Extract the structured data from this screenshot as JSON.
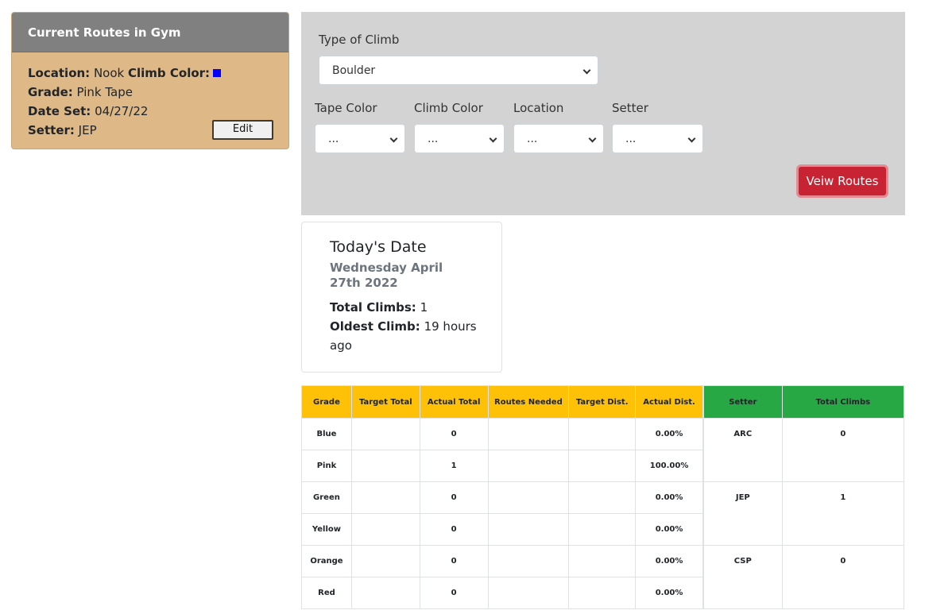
{
  "route_card": {
    "header": "Current Routes in Gym",
    "location_label": "Location:",
    "location_value": "Nook",
    "climb_color_label": "Climb Color:",
    "climb_color": "#0000ff",
    "grade_label": "Grade:",
    "grade_value": "Pink Tape",
    "date_set_label": "Date Set:",
    "date_set_value": "04/27/22",
    "setter_label": "Setter:",
    "setter_value": "JEP",
    "edit_label": "Edit"
  },
  "filters": {
    "type_label": "Type of Climb",
    "type_value": "Boulder",
    "tape_color_label": "Tape Color",
    "tape_color_value": "...",
    "climb_color_label": "Climb Color",
    "climb_color_value": "...",
    "location_label": "Location",
    "location_value": "...",
    "setter_label": "Setter",
    "setter_value": "...",
    "view_button": "Veiw Routes"
  },
  "date_card": {
    "title": "Today's Date",
    "date": "Wednesday April 27th 2022",
    "total_label": "Total Climbs:",
    "total_value": "1",
    "oldest_label": "Oldest Climb:",
    "oldest_value": "19 hours ago"
  },
  "grade_table": {
    "headers": [
      "Grade",
      "Target Total",
      "Actual Total",
      "Routes Needed",
      "Target Dist.",
      "Actual Dist."
    ],
    "rows": [
      [
        "Blue",
        "",
        "0",
        "",
        "",
        "0.00%"
      ],
      [
        "Pink",
        "",
        "1",
        "",
        "",
        "100.00%"
      ],
      [
        "Green",
        "",
        "0",
        "",
        "",
        "0.00%"
      ],
      [
        "Yellow",
        "",
        "0",
        "",
        "",
        "0.00%"
      ],
      [
        "Orange",
        "",
        "0",
        "",
        "",
        "0.00%"
      ],
      [
        "Red",
        "",
        "0",
        "",
        "",
        "0.00%"
      ]
    ]
  },
  "setter_table": {
    "headers": [
      "Setter",
      "Total Climbs"
    ],
    "rows": [
      [
        "ARC",
        "0"
      ],
      [
        "JEP",
        "1"
      ],
      [
        "CSP",
        "0"
      ]
    ]
  },
  "colors": {
    "grade_header": "#ffc107",
    "setter_header": "#28a745",
    "view_button": "#c82333",
    "card_body": "#deb887",
    "card_header": "#808080",
    "panel": "#d3d3d3"
  }
}
